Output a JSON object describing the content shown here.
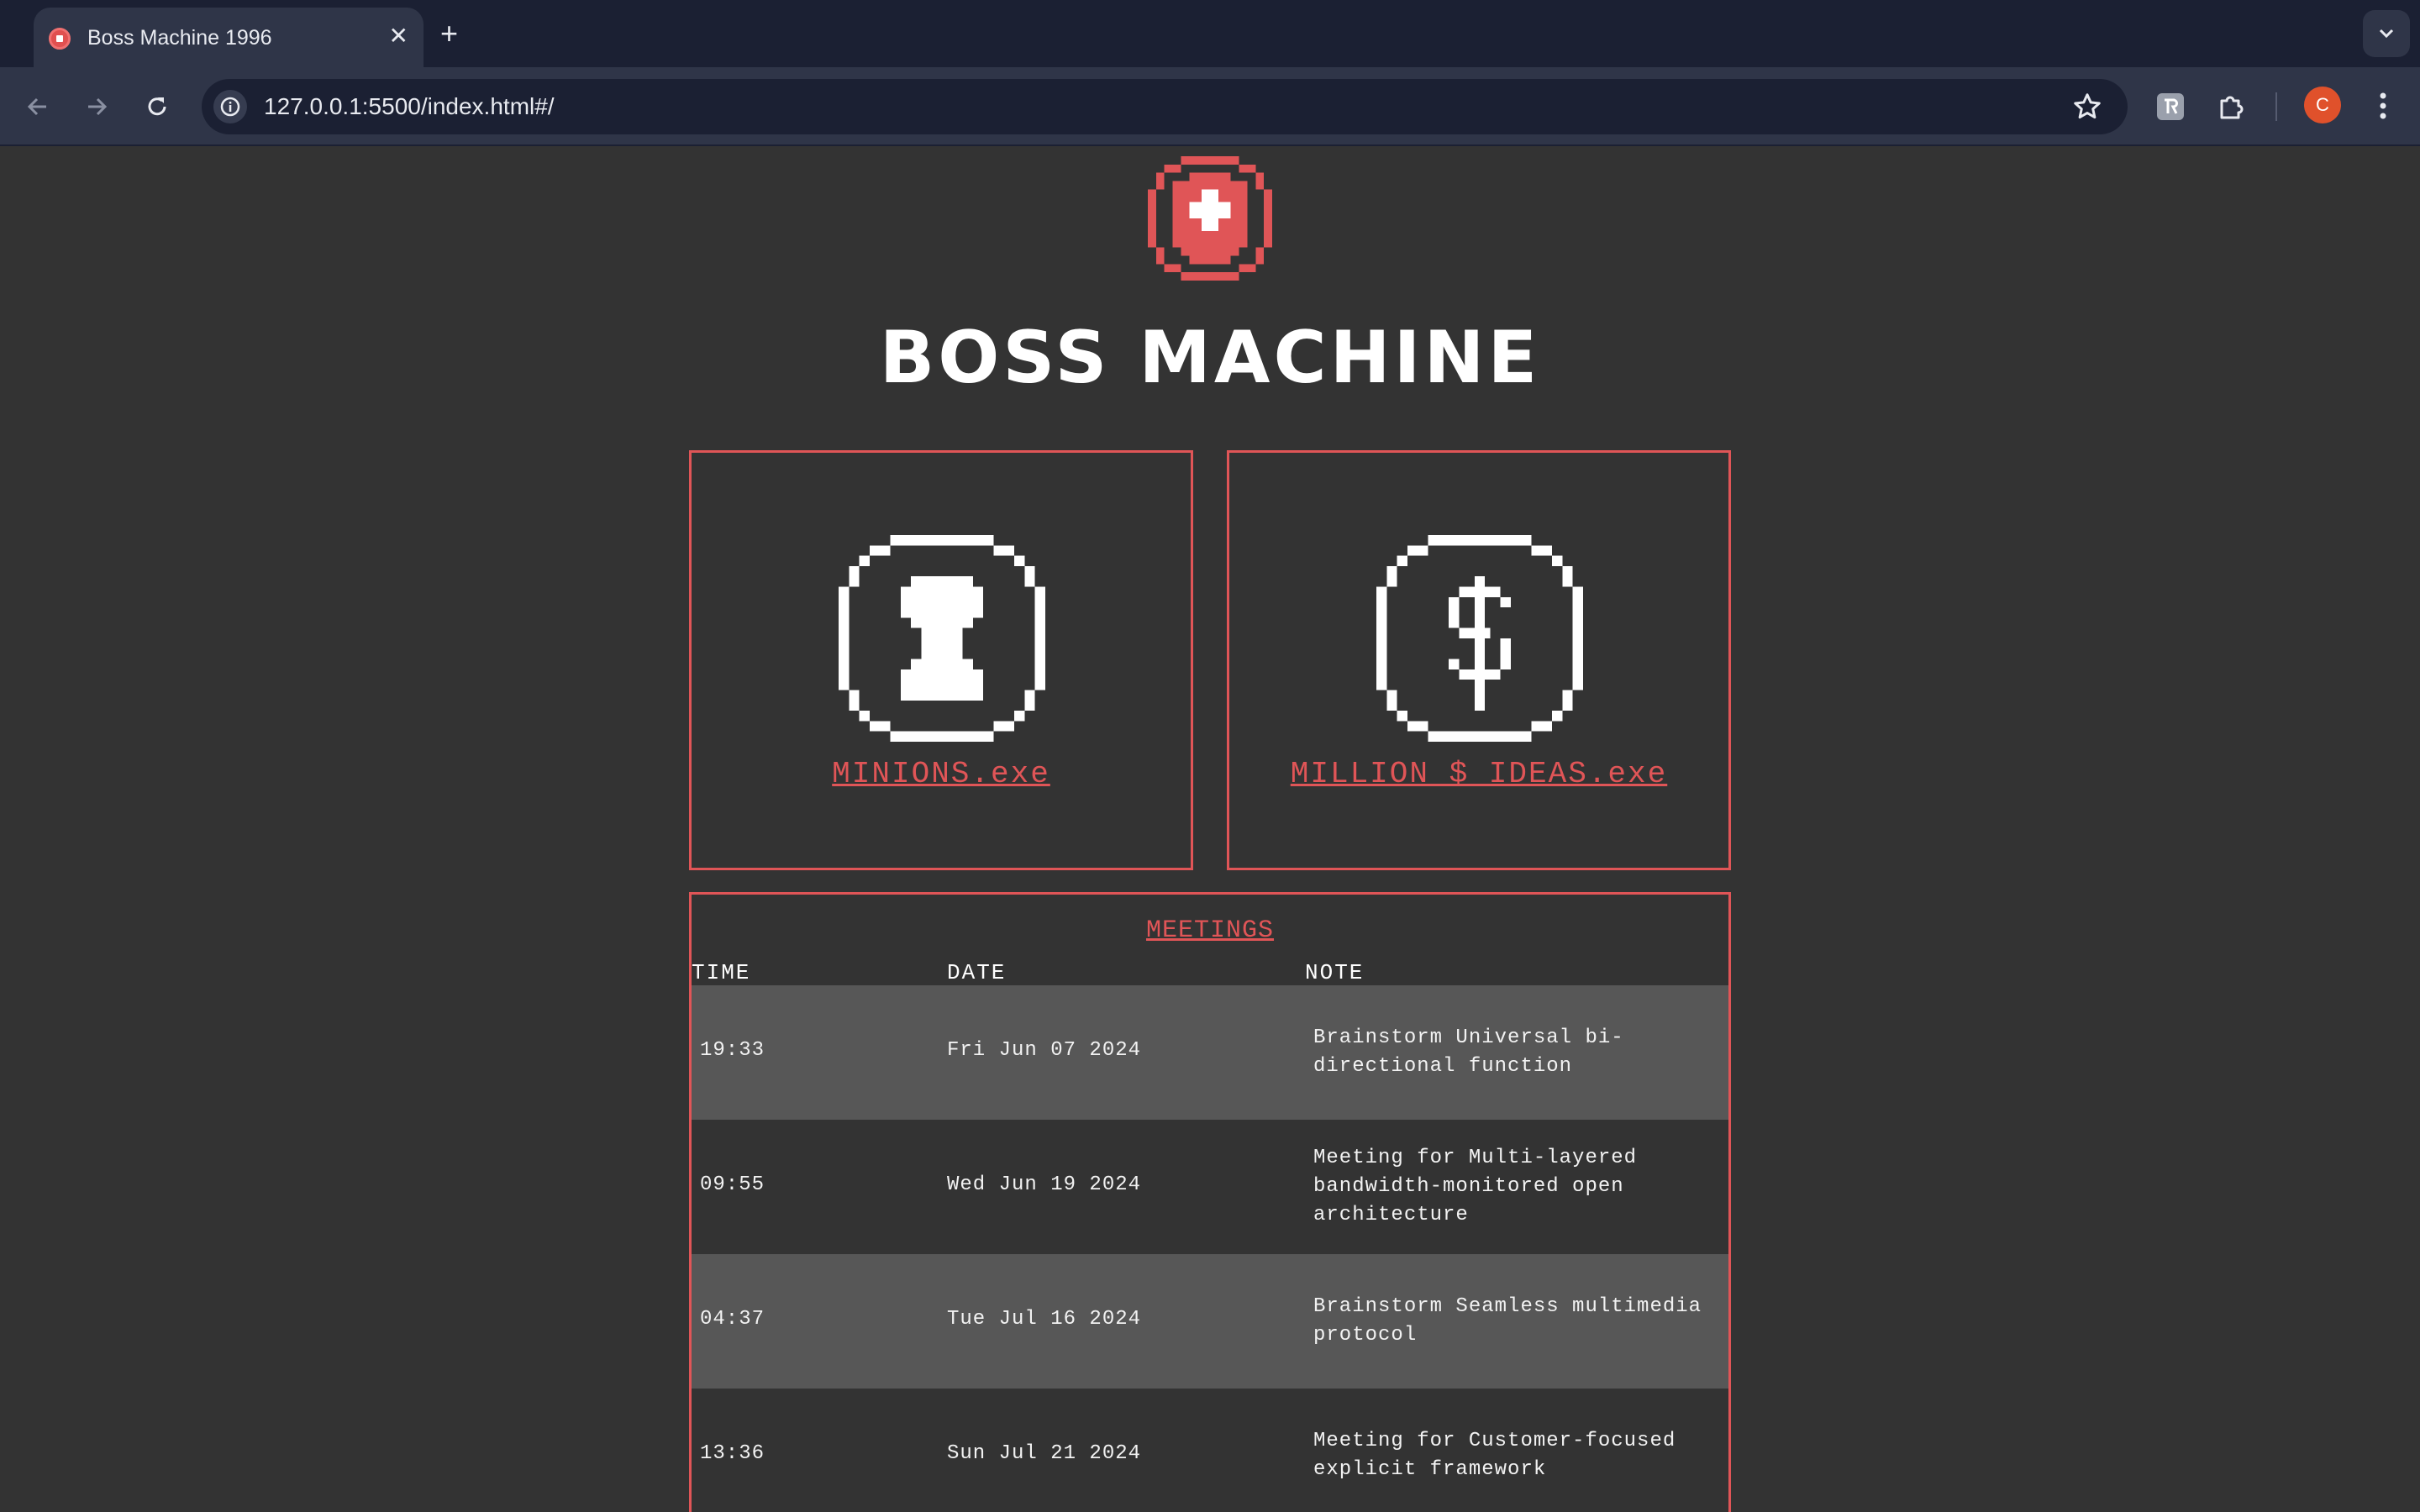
{
  "browser": {
    "tab_title": "Boss Machine 1996",
    "url": "127.0.0.1:5500/index.html#/",
    "profile_initial": "C"
  },
  "app": {
    "title": "BOSS MACHINE",
    "cards": [
      {
        "label": "MINIONS.exe",
        "icon": "minion-icon"
      },
      {
        "label": "MILLION $ IDEAS.exe",
        "icon": "dollar-coin-icon"
      }
    ]
  },
  "meetings": {
    "title": "MEETINGS",
    "headers": {
      "time": "TIME",
      "date": "DATE",
      "note": "NOTE"
    },
    "rows": [
      {
        "time": "19:33",
        "date": "Fri Jun 07 2024",
        "note": "Brainstorm Universal bi-directional function"
      },
      {
        "time": "09:55",
        "date": "Wed Jun 19 2024",
        "note": "Meeting for Multi-layered bandwidth-monitored open architecture"
      },
      {
        "time": "04:37",
        "date": "Tue Jul 16 2024",
        "note": "Brainstorm Seamless multimedia protocol"
      },
      {
        "time": "13:36",
        "date": "Sun Jul 21 2024",
        "note": "Meeting for Customer-focused explicit framework"
      }
    ]
  },
  "colors": {
    "accent": "#e05557",
    "background": "#333333",
    "row_alt": "#575757",
    "chrome_dark": "#1b2033",
    "chrome": "#2f3548"
  }
}
